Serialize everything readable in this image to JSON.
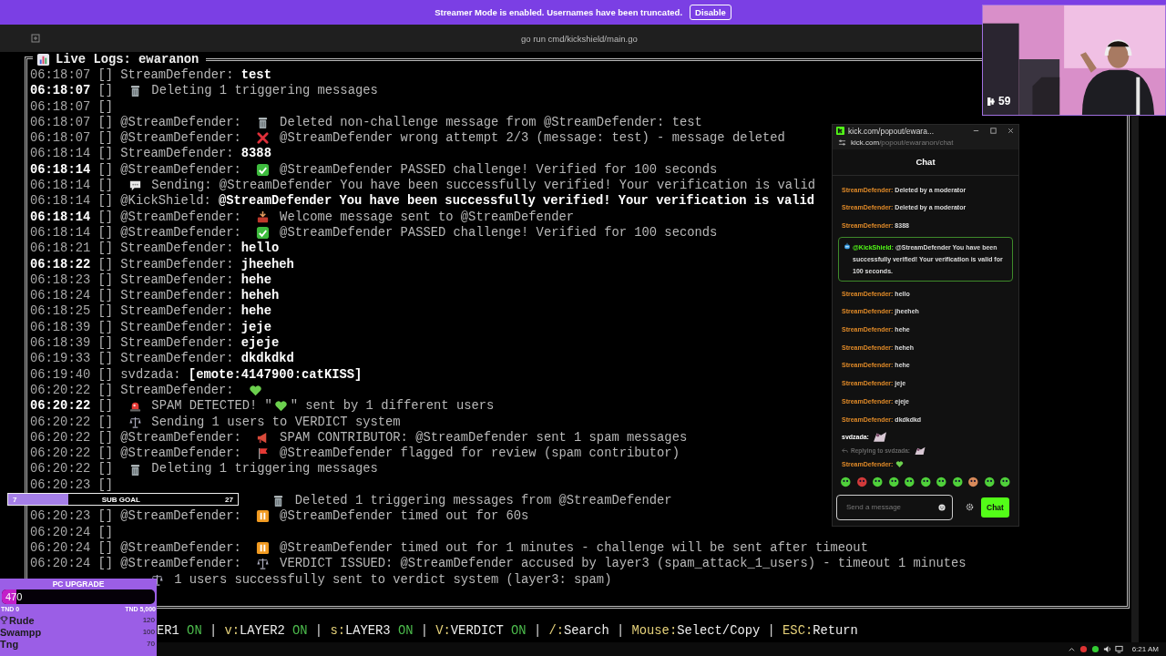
{
  "banner": {
    "text": "Streamer Mode is enabled. Usernames have been truncated.",
    "button": "Disable"
  },
  "window": {
    "title": "go run cmd/kickshield/main.go"
  },
  "log": {
    "title": "Live Logs: ewaranon",
    "lines": [
      {
        "kind": "entry",
        "time": "06:18:07",
        "bright": false,
        "tag": "[]",
        "user": "StreamDefender:",
        "parts": [
          {
            "kind": "chat",
            "text": "test"
          }
        ]
      },
      {
        "kind": "entry",
        "time": "06:18:07",
        "bright": true,
        "tag": "[]",
        "parts": [
          {
            "kind": "trash"
          },
          {
            "kind": "text",
            "text": "Deleting 1 triggering messages"
          }
        ]
      },
      {
        "kind": "entry",
        "time": "06:18:07",
        "bright": false,
        "tag": "[]"
      },
      {
        "kind": "entry",
        "time": "06:18:07",
        "bright": false,
        "tag": "[]",
        "user": "@StreamDefender:",
        "parts": [
          {
            "kind": "trash"
          },
          {
            "kind": "text",
            "text": "Deleted non-challenge message from @StreamDefender: test"
          }
        ]
      },
      {
        "kind": "entry",
        "time": "06:18:07",
        "bright": false,
        "tag": "[]",
        "user": "@StreamDefender:",
        "parts": [
          {
            "kind": "cross"
          },
          {
            "kind": "text",
            "text": "@StreamDefender wrong attempt 2/3 (message: test) - message deleted"
          }
        ]
      },
      {
        "kind": "entry",
        "time": "06:18:14",
        "bright": false,
        "tag": "[]",
        "user": "StreamDefender:",
        "parts": [
          {
            "kind": "chat",
            "text": "8388"
          }
        ]
      },
      {
        "kind": "entry",
        "time": "06:18:14",
        "bright": true,
        "tag": "[]",
        "user": "@StreamDefender:",
        "parts": [
          {
            "kind": "check"
          },
          {
            "kind": "text",
            "text": "@StreamDefender PASSED challenge! Verified for 100 seconds"
          }
        ]
      },
      {
        "kind": "entry",
        "time": "06:18:14",
        "bright": false,
        "tag": "[]",
        "parts": [
          {
            "kind": "speech"
          },
          {
            "kind": "text",
            "text": "Sending: @StreamDefender You have been successfully verified! Your verification is valid"
          }
        ]
      },
      {
        "kind": "entry",
        "time": "06:18:14",
        "bright": false,
        "tag": "[]",
        "user": "@KickShield:",
        "parts": [
          {
            "kind": "chat",
            "text": "@StreamDefender You have been successfully verified! Your verification is valid"
          }
        ]
      },
      {
        "kind": "entry",
        "time": "06:18:14",
        "bright": true,
        "tag": "[]",
        "user": "@StreamDefender:",
        "parts": [
          {
            "kind": "tray"
          },
          {
            "kind": "text",
            "text": "Welcome message sent to @StreamDefender"
          }
        ]
      },
      {
        "kind": "entry",
        "time": "06:18:14",
        "bright": false,
        "tag": "[]",
        "user": "@StreamDefender:",
        "parts": [
          {
            "kind": "check"
          },
          {
            "kind": "text",
            "text": "@StreamDefender PASSED challenge! Verified for 100 seconds"
          }
        ]
      },
      {
        "kind": "entry",
        "time": "06:18:21",
        "bright": false,
        "tag": "[]",
        "user": "StreamDefender:",
        "parts": [
          {
            "kind": "chat",
            "text": "hello"
          }
        ]
      },
      {
        "kind": "entry",
        "time": "06:18:22",
        "bright": true,
        "tag": "[]",
        "user": "StreamDefender:",
        "parts": [
          {
            "kind": "chat",
            "text": "jheeheh"
          }
        ]
      },
      {
        "kind": "entry",
        "time": "06:18:23",
        "bright": false,
        "tag": "[]",
        "user": "StreamDefender:",
        "parts": [
          {
            "kind": "chat",
            "text": "hehe"
          }
        ]
      },
      {
        "kind": "entry",
        "time": "06:18:24",
        "bright": false,
        "tag": "[]",
        "user": "StreamDefender:",
        "parts": [
          {
            "kind": "chat",
            "text": "heheh"
          }
        ]
      },
      {
        "kind": "entry",
        "time": "06:18:25",
        "bright": false,
        "tag": "[]",
        "user": "StreamDefender:",
        "parts": [
          {
            "kind": "chat",
            "text": "hehe"
          }
        ]
      },
      {
        "kind": "entry",
        "time": "06:18:39",
        "bright": false,
        "tag": "[]",
        "user": "StreamDefender:",
        "parts": [
          {
            "kind": "chat",
            "text": "jeje"
          }
        ]
      },
      {
        "kind": "entry",
        "time": "06:18:39",
        "bright": false,
        "tag": "[]",
        "user": "StreamDefender:",
        "parts": [
          {
            "kind": "chat",
            "text": "ejeje"
          }
        ]
      },
      {
        "kind": "entry",
        "time": "06:19:33",
        "bright": false,
        "tag": "[]",
        "user": "StreamDefender:",
        "parts": [
          {
            "kind": "chat",
            "text": "dkdkdkd"
          }
        ]
      },
      {
        "kind": "entry",
        "time": "06:19:40",
        "bright": false,
        "tag": "[]",
        "user": "svdzada:",
        "parts": [
          {
            "kind": "chat",
            "text": "[emote:4147900:catKISS]"
          }
        ]
      },
      {
        "kind": "entry",
        "time": "06:20:22",
        "bright": false,
        "tag": "[]",
        "user": "StreamDefender:",
        "parts": [
          {
            "kind": "heart"
          }
        ]
      },
      {
        "kind": "entry",
        "time": "06:20:22",
        "bright": true,
        "tag": "[]",
        "parts": [
          {
            "kind": "siren"
          },
          {
            "kind": "text",
            "text": "SPAM DETECTED! \""
          },
          {
            "kind": "heart"
          },
          {
            "kind": "text",
            "text": "\" sent by 1 different users"
          }
        ]
      },
      {
        "kind": "entry",
        "time": "06:20:22",
        "bright": false,
        "tag": "[]",
        "parts": [
          {
            "kind": "scales"
          },
          {
            "kind": "text",
            "text": "Sending 1 users to VERDICT system"
          }
        ]
      },
      {
        "kind": "entry",
        "time": "06:20:22",
        "bright": false,
        "tag": "[]",
        "user": "@StreamDefender:",
        "parts": [
          {
            "kind": "megaphone"
          },
          {
            "kind": "text",
            "text": "SPAM CONTRIBUTOR: @StreamDefender sent 1 spam messages"
          }
        ]
      },
      {
        "kind": "entry",
        "time": "06:20:22",
        "bright": false,
        "tag": "[]",
        "user": "@StreamDefender:",
        "parts": [
          {
            "kind": "flag"
          },
          {
            "kind": "text",
            "text": "@StreamDefender flagged for review (spam contributor)"
          }
        ]
      },
      {
        "kind": "entry",
        "time": "06:20:22",
        "bright": false,
        "tag": "[]",
        "parts": [
          {
            "kind": "trash"
          },
          {
            "kind": "text",
            "text": "Deleting 1 triggering messages"
          }
        ]
      },
      {
        "kind": "entry",
        "time": "06:20:23",
        "bright": false,
        "tag": "[]"
      },
      {
        "kind": "covered-wide",
        "parts": [
          {
            "kind": "trash"
          },
          {
            "kind": "text",
            "text": "Deleted 1 triggering messages from @StreamDefender"
          }
        ]
      },
      {
        "kind": "entry",
        "time": "06:20:23",
        "bright": false,
        "tag": "[]",
        "user": "@StreamDefender:",
        "parts": [
          {
            "kind": "pause"
          },
          {
            "kind": "text",
            "text": "@StreamDefender timed out for 60s"
          }
        ]
      },
      {
        "kind": "entry",
        "time": "06:20:24",
        "bright": false,
        "tag": "[]"
      },
      {
        "kind": "entry",
        "time": "06:20:24",
        "bright": false,
        "tag": "[]",
        "user": "@StreamDefender:",
        "parts": [
          {
            "kind": "pause"
          },
          {
            "kind": "text",
            "text": "@StreamDefender timed out for 1 minutes - challenge will be sent after timeout"
          }
        ]
      },
      {
        "kind": "entry",
        "time": "06:20:24",
        "bright": false,
        "tag": "[]",
        "user": "@StreamDefender:",
        "parts": [
          {
            "kind": "scales"
          },
          {
            "kind": "text",
            "text": "VERDICT ISSUED: @StreamDefender accused by layer3 (spam_attack_1_users) - timeout 1 minutes"
          }
        ]
      },
      {
        "kind": "covered-narrow",
        "parts": [
          {
            "kind": "scales"
          },
          {
            "kind": "text",
            "text": "1 users successfully sent to verdict system (layer3: spam)"
          }
        ]
      }
    ]
  },
  "status_bar": {
    "separator": "|",
    "items": [
      {
        "label": "ER1",
        "value": "ON"
      },
      {
        "key": "v:",
        "label": "LAYER2",
        "value": "ON"
      },
      {
        "key": "s:",
        "label": "LAYER3",
        "value": "ON"
      },
      {
        "key": "V:",
        "label": "VERDICT",
        "value": "ON"
      },
      {
        "key": "/:",
        "label": "Search"
      },
      {
        "key": "Mouse:",
        "label": "Select/Copy"
      },
      {
        "key": "ESC:",
        "label": "Return"
      }
    ]
  },
  "taskbar": {
    "time": "6:21 AM"
  },
  "webcam": {
    "kind": "picture",
    "badge": "59"
  },
  "chat": {
    "tab_title": "kick.com/popout/ewara...",
    "url_host": "kick.com",
    "url_path": "/popout/ewaranon/chat",
    "header": "Chat",
    "messages": [
      {
        "kind": "message",
        "user": "StreamDefender:",
        "text": "Deleted by a moderator"
      },
      {
        "kind": "message",
        "user": "StreamDefender:",
        "text": "Deleted by a moderator"
      },
      {
        "kind": "message",
        "user": "StreamDefender:",
        "text": "8388"
      },
      {
        "kind": "bot",
        "user": "@KickShield:",
        "text": "@StreamDefender You have been successfully verified! Your verification is valid for 100 seconds."
      },
      {
        "kind": "message",
        "user": "StreamDefender:",
        "text": "hello"
      },
      {
        "kind": "message",
        "user": "StreamDefender:",
        "text": "jheeheh"
      },
      {
        "kind": "message",
        "user": "StreamDefender:",
        "text": "hehe"
      },
      {
        "kind": "message",
        "user": "StreamDefender:",
        "text": "heheh"
      },
      {
        "kind": "message",
        "user": "StreamDefender:",
        "text": "hehe"
      },
      {
        "kind": "message",
        "user": "StreamDefender:",
        "text": "jeje"
      },
      {
        "kind": "message",
        "user": "StreamDefender:",
        "text": "ejeje"
      },
      {
        "kind": "message",
        "user": "StreamDefender:",
        "text": "dkdkdkd"
      },
      {
        "kind": "emote",
        "user": "svdzada:"
      },
      {
        "kind": "reply",
        "text": "Replying to svdzada:"
      },
      {
        "kind": "heart",
        "user": "StreamDefender:"
      }
    ],
    "input": {
      "placeholder": "Send a message"
    },
    "send_button": "Chat"
  },
  "sub_goal": {
    "current": "7",
    "label": "SUB GOAL",
    "target": "27",
    "level": 0.26
  },
  "donation_goal": {
    "title": "PC UPGRADE",
    "amount": "470",
    "level": 0.094,
    "min": "TND 0",
    "max": "TND 5,000",
    "leaders": [
      {
        "kind": "top",
        "name": "Rude",
        "amount": "120"
      },
      {
        "kind": "entry",
        "name": "Swampp",
        "amount": "100"
      },
      {
        "kind": "entry",
        "name": "Tng",
        "amount": "70"
      }
    ]
  }
}
